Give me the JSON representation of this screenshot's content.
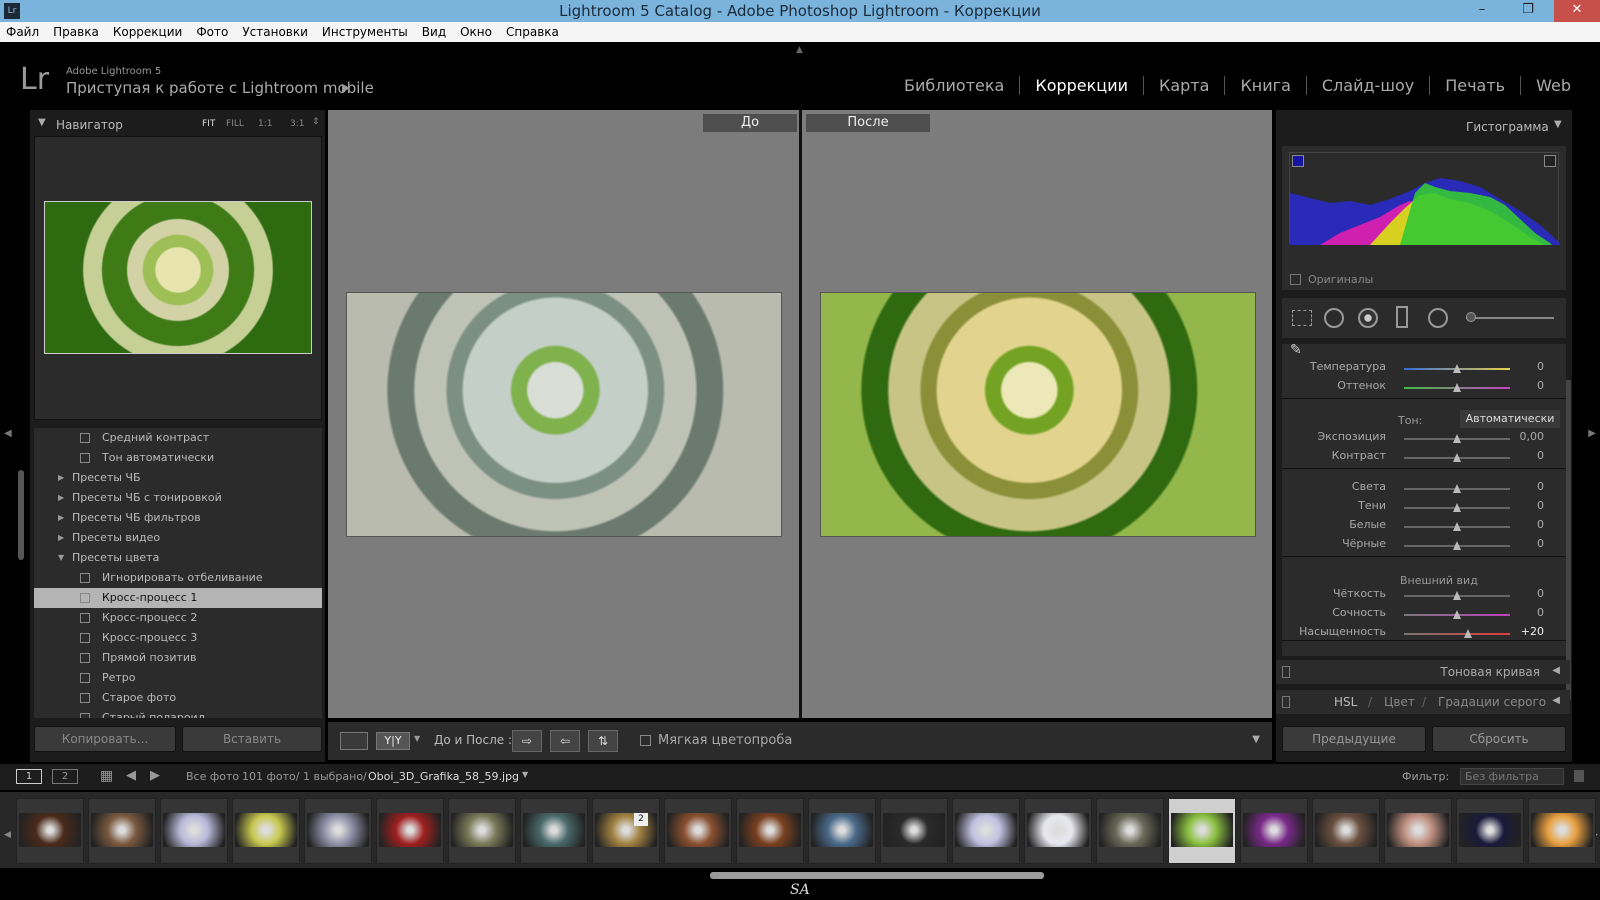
{
  "window": {
    "title": "Lightroom 5 Catalog - Adobe Photoshop Lightroom - Коррекции",
    "logo": "Lr",
    "min": "–",
    "max": "❐",
    "close": "✕"
  },
  "menu": [
    "Файл",
    "Правка",
    "Коррекции",
    "Фото",
    "Установки",
    "Инструменты",
    "Вид",
    "Окно",
    "Справка"
  ],
  "identity": {
    "logo": "Lr",
    "small": "Adobe Lightroom 5",
    "big": "Приступая к работе с Lightroom mobile",
    "arrow": "▶"
  },
  "modules": [
    "Библиотека",
    "Коррекции",
    "Карта",
    "Книга",
    "Слайд-шоу",
    "Печать",
    "Web"
  ],
  "navigator": {
    "title": "Навигатор",
    "zoom": [
      "FIT",
      "FILL",
      "1:1",
      "3:1"
    ]
  },
  "presets": [
    {
      "label": "Средний контраст",
      "type": "item"
    },
    {
      "label": "Тон автоматически",
      "type": "item"
    },
    {
      "label": "Пресеты ЧБ",
      "type": "folder"
    },
    {
      "label": "Пресеты ЧБ с тонировкой",
      "type": "folder"
    },
    {
      "label": "Пресеты ЧБ фильтров",
      "type": "folder"
    },
    {
      "label": "Пресеты видео",
      "type": "folder"
    },
    {
      "label": "Пресеты цвета",
      "type": "open"
    },
    {
      "label": "Игнорировать отбеливание",
      "type": "item"
    },
    {
      "label": "Кросс-процесс 1",
      "type": "item",
      "selected": true
    },
    {
      "label": "Кросс-процесс 2",
      "type": "item"
    },
    {
      "label": "Кросс-процесс 3",
      "type": "item"
    },
    {
      "label": "Прямой позитив",
      "type": "item"
    },
    {
      "label": "Ретро",
      "type": "item"
    },
    {
      "label": "Старое фото",
      "type": "item"
    },
    {
      "label": "Старый полароид",
      "type": "item"
    }
  ],
  "left_buttons": {
    "copy": "Копировать...",
    "paste": "Вставить"
  },
  "compare": {
    "before": "До",
    "after": "После"
  },
  "toolbar": {
    "yy": "Y|Y",
    "before_after": "До и После :",
    "softproof": "Мягкая цветопроба"
  },
  "histogram": {
    "title": "Гистограмма",
    "originals": "Оригиналы"
  },
  "basic": {
    "tone_label": "Тон:",
    "auto": "Автоматически",
    "appearance": "Внешний вид",
    "sliders": [
      {
        "label": "Температура",
        "value": "0",
        "pos": 0.5,
        "group": "wb"
      },
      {
        "label": "Оттенок",
        "value": "0",
        "pos": 0.5,
        "group": "wb"
      },
      {
        "label": "Экспозиция",
        "value": "0,00",
        "pos": 0.5,
        "group": "tone"
      },
      {
        "label": "Контраст",
        "value": "0",
        "pos": 0.5,
        "group": "tone"
      },
      {
        "label": "Света",
        "value": "0",
        "pos": 0.5,
        "group": "tone2"
      },
      {
        "label": "Тени",
        "value": "0",
        "pos": 0.5,
        "group": "tone2"
      },
      {
        "label": "Белые",
        "value": "0",
        "pos": 0.5,
        "group": "tone2"
      },
      {
        "label": "Чёрные",
        "value": "0",
        "pos": 0.5,
        "group": "tone2"
      },
      {
        "label": "Чёткость",
        "value": "0",
        "pos": 0.5,
        "group": "app"
      },
      {
        "label": "Сочность",
        "value": "0",
        "pos": 0.5,
        "group": "app"
      },
      {
        "label": "Насыщенность",
        "value": "+20",
        "pos": 0.6,
        "group": "app"
      }
    ]
  },
  "sections": {
    "tone_curve": "Тоновая кривая",
    "hsl": "HSL",
    "color": "Цвет",
    "gray": "Градации серого"
  },
  "right_buttons": {
    "prev": "Предыдущие",
    "reset": "Сбросить"
  },
  "filmstrip": {
    "page1": "1",
    "page2": "2",
    "source": "Все фото",
    "count": "101 фото/ 1 выбрано/",
    "file": "Oboi_3D_Grafika_58_59.jpg",
    "filter_label": "Фильтр:",
    "filter_value": "Без фильтра",
    "badge": "2"
  },
  "watermark": "SA",
  "colors": {
    "accent": "#7ab3dc",
    "panel": "#2b2b2b",
    "selected": "#b4b4b4"
  }
}
